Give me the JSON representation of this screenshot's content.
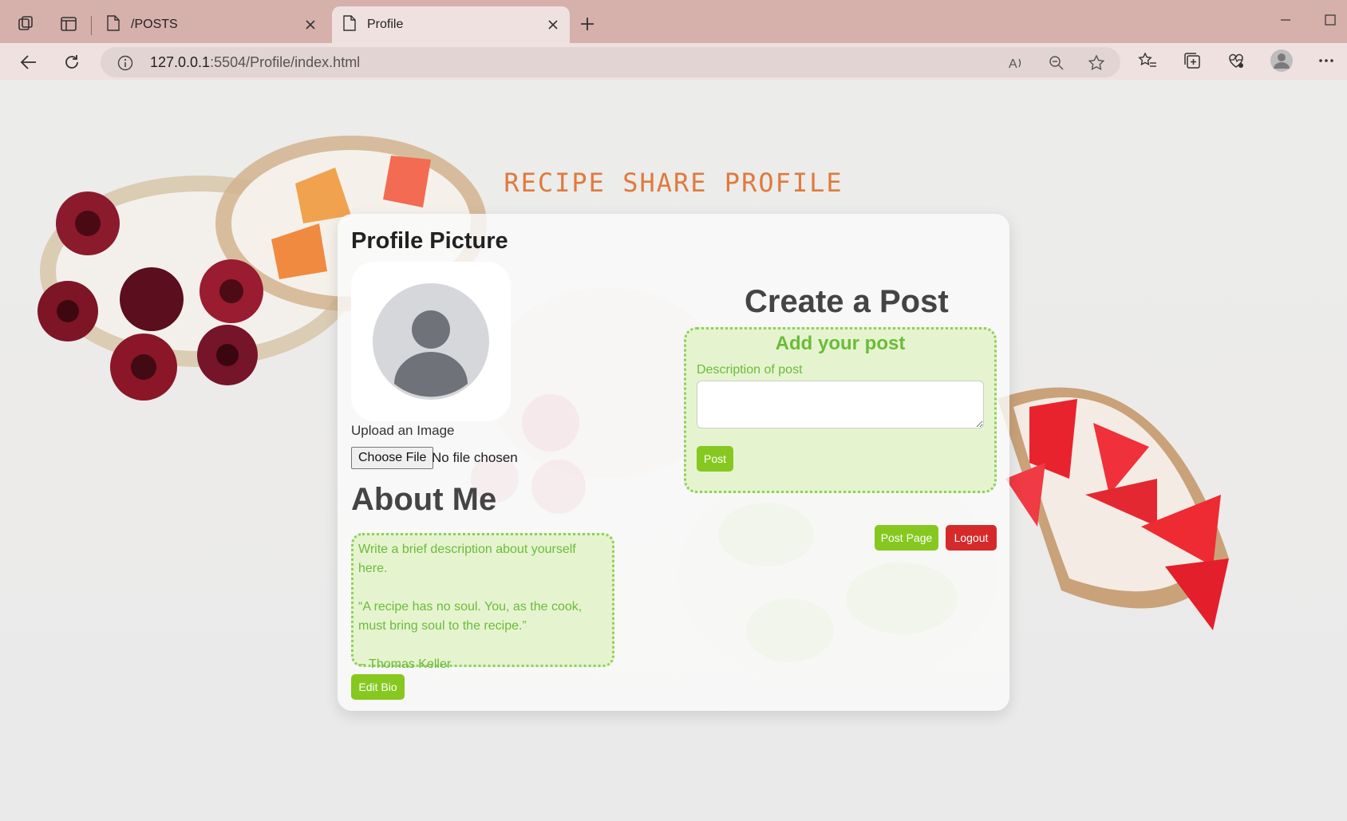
{
  "browser": {
    "tabs": [
      {
        "title": "/POSTS",
        "active": false
      },
      {
        "title": "Profile",
        "active": true
      }
    ],
    "url": {
      "host": "127.0.0.1",
      "path": ":5504/Profile/index.html"
    }
  },
  "site": {
    "title": "RECIPE SHARE PROFILE"
  },
  "profile": {
    "picture_title": "Profile Picture",
    "upload_label": "Upload an Image",
    "choose_file": "Choose File",
    "file_status": "No file chosen"
  },
  "about": {
    "title": "About Me",
    "bio_lines": [
      "Write a brief description about yourself here.",
      "“A recipe has no soul. You, as the cook, must bring soul to the recipe.”",
      "– Thomas Keller"
    ],
    "edit_button": "Edit Bio"
  },
  "create_post": {
    "title": "Create a Post",
    "box_title": "Add your post",
    "description_label": "Description of post",
    "description_value": "",
    "post_button": "Post"
  },
  "actions": {
    "post_page": "Post Page",
    "logout": "Logout"
  },
  "colors": {
    "title_orange": "#e07a3c",
    "green": "#86c81f",
    "green_text": "#6bbb3a",
    "green_bg": "#e5f4cf",
    "red": "#d62a2a",
    "tab_bar": "#d6b0ab"
  }
}
